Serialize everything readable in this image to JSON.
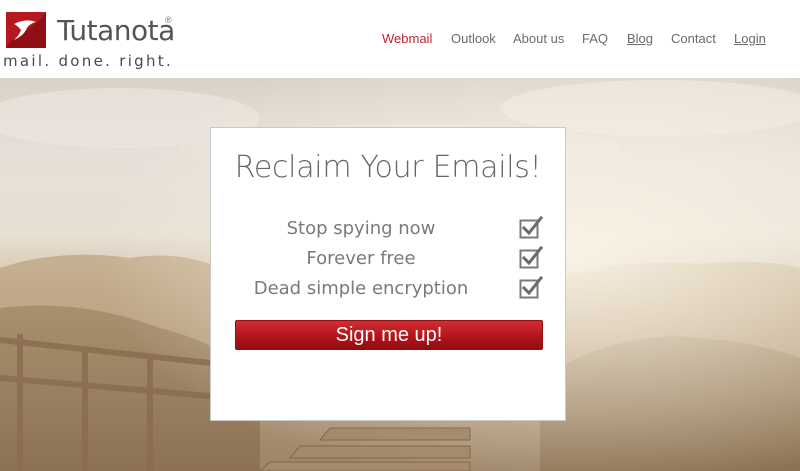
{
  "brand": {
    "name_part1": "Tuta",
    "name_part2": "nota",
    "registered": "®",
    "tagline": "mail. done. right."
  },
  "nav": {
    "items": [
      {
        "label": "Webmail",
        "active": true
      },
      {
        "label": "Outlook"
      },
      {
        "label": "About us"
      },
      {
        "label": "FAQ"
      },
      {
        "label": "Blog",
        "underline": true
      },
      {
        "label": "Contact"
      },
      {
        "label": "Login",
        "underline": true
      }
    ]
  },
  "card": {
    "title": "Reclaim Your Emails!",
    "features": [
      {
        "label": "Stop spying now",
        "icon": "checkbox-checked-icon"
      },
      {
        "label": "Forever free",
        "icon": "checkbox-checked-icon"
      },
      {
        "label": "Dead simple encryption",
        "icon": "checkbox-checked-icon"
      }
    ],
    "cta_label": "Sign me up!"
  },
  "colors": {
    "accent": "#c0272d",
    "nav_text": "#6b6b6b",
    "title_text": "#666666"
  }
}
